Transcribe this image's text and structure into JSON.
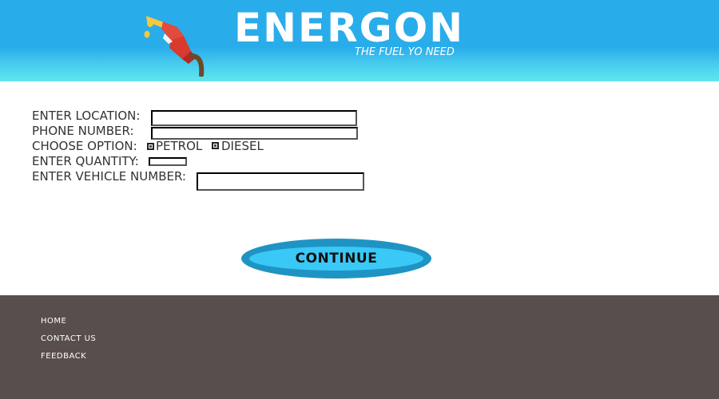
{
  "header": {
    "title": "ENERGON",
    "tagline": "THE FUEL YO NEED",
    "icon": "fuel-pump-nozzle-icon",
    "gradient_colors": [
      "#29acea",
      "#5fe6ee"
    ]
  },
  "form": {
    "location": {
      "label": "ENTER LOCATION:",
      "value": ""
    },
    "phone": {
      "label": "PHONE NUMBER:",
      "value": ""
    },
    "fuel_option": {
      "label": "CHOOSE OPTION:",
      "options": [
        "PETROL",
        "DIESEL"
      ]
    },
    "quantity": {
      "label": "ENTER QUANTITY:",
      "value": ""
    },
    "vehicle": {
      "label": "ENTER VEHICLE NUMBER:",
      "value": ""
    }
  },
  "continue_button": {
    "label": "CONTINUE",
    "color": "#3ac8f7",
    "border_color": "#1f94c4"
  },
  "footer": {
    "background": "#594e4e",
    "links": [
      "HOME",
      "CONTACT US",
      "FEEDBACK"
    ]
  }
}
